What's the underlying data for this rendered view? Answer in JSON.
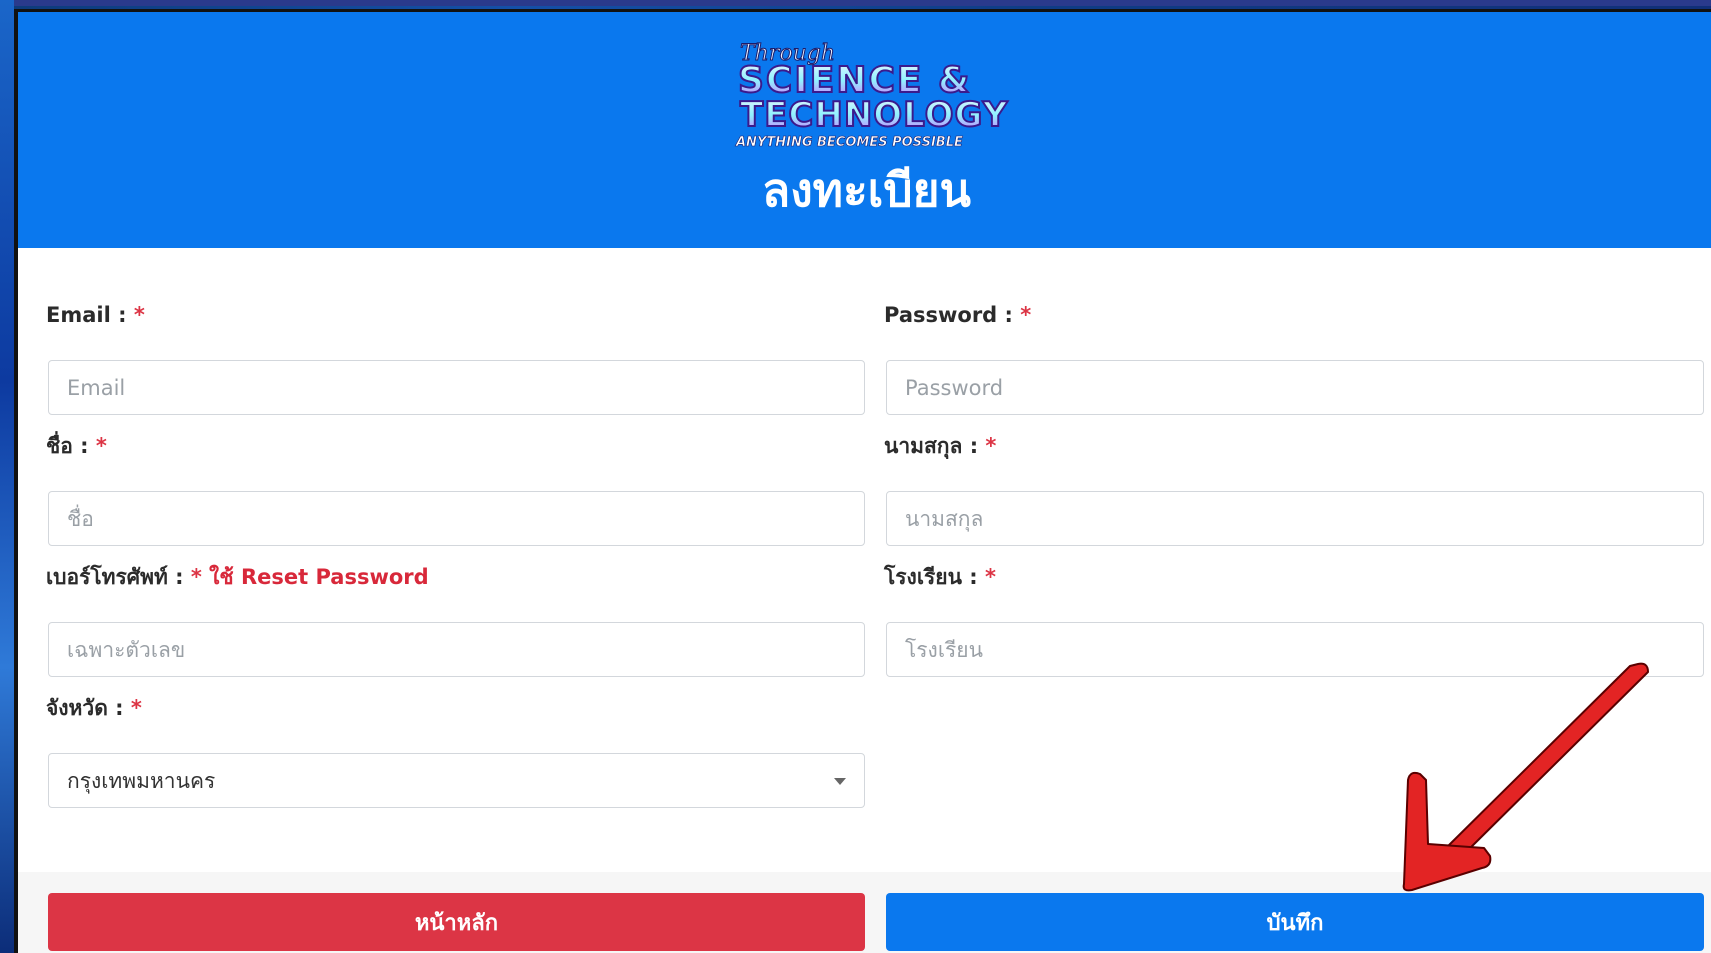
{
  "logo": {
    "line1": "Through",
    "line2": "SCIENCE &",
    "line3": "TECHNOLOGY",
    "line4": "ANYTHING BECOMES POSSIBLE"
  },
  "page_title": "ลงทะเบียน",
  "form": {
    "email": {
      "label": "Email :",
      "required_mark": "*",
      "placeholder": "Email"
    },
    "password": {
      "label": "Password :",
      "required_mark": "*",
      "placeholder": "Password"
    },
    "first_name": {
      "label": "ชื่อ :",
      "required_mark": "*",
      "placeholder": "ชื่อ"
    },
    "last_name": {
      "label": "นามสกุล :",
      "required_mark": "*",
      "placeholder": "นามสกุล"
    },
    "phone": {
      "label": "เบอร์โทรศัพท์ :",
      "required_mark": "*",
      "hint": "ใช้ Reset Password",
      "placeholder": "เฉพาะตัวเลข"
    },
    "school": {
      "label": "โรงเรียน :",
      "required_mark": "*",
      "placeholder": "โรงเรียน"
    },
    "province": {
      "label": "จังหวัด :",
      "required_mark": "*",
      "selected_value": "กรุงเทพมหานคร"
    }
  },
  "buttons": {
    "home_label": "หน้าหลัก",
    "save_label": "บันทึก"
  },
  "colors": {
    "header_blue": "#0a78ee",
    "primary_blue": "#0a78ee",
    "danger_red": "#dc3545",
    "required_red": "#dc3545",
    "annotation_arrow": "#e32424"
  },
  "icons": {
    "select_caret": "chevron-down-icon",
    "annotation": "red-arrow-pointer"
  }
}
